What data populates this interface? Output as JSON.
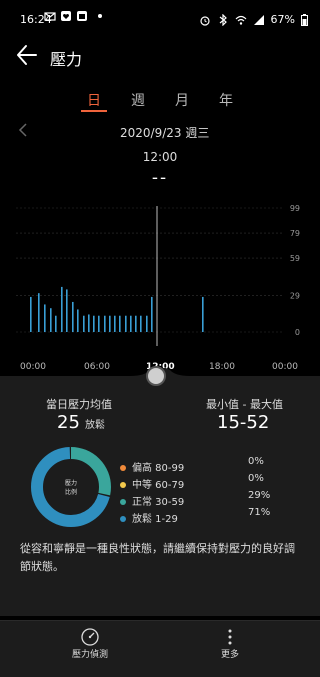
{
  "status_bar": {
    "time": "16:24",
    "battery": "67%"
  },
  "header": {
    "title": "壓力"
  },
  "tabs": [
    {
      "label": "日",
      "active": true
    },
    {
      "label": "週",
      "active": false
    },
    {
      "label": "月",
      "active": false
    },
    {
      "label": "年",
      "active": false
    }
  ],
  "date_nav": {
    "date": "2020/9/23  週三"
  },
  "readout": {
    "time": "12:00",
    "value": "--"
  },
  "chart_data": {
    "type": "bar",
    "y_ticks": [
      "99",
      "79",
      "59",
      "29",
      "0"
    ],
    "ylim": [
      0,
      99
    ],
    "x_ticks": [
      "00:00",
      "06:00",
      "12:00",
      "18:00",
      "00:00"
    ],
    "bars": [
      {
        "x": 30,
        "y": 28
      },
      {
        "x": 38,
        "y": 31
      },
      {
        "x": 44,
        "y": 22
      },
      {
        "x": 50,
        "y": 19
      },
      {
        "x": 55,
        "y": 13
      },
      {
        "x": 61,
        "y": 36
      },
      {
        "x": 66,
        "y": 34
      },
      {
        "x": 72,
        "y": 24
      },
      {
        "x": 77,
        "y": 18
      },
      {
        "x": 83,
        "y": 13
      },
      {
        "x": 88,
        "y": 14
      },
      {
        "x": 93,
        "y": 13
      },
      {
        "x": 98,
        "y": 13
      },
      {
        "x": 104,
        "y": 13
      },
      {
        "x": 109,
        "y": 13
      },
      {
        "x": 114,
        "y": 13
      },
      {
        "x": 119,
        "y": 13
      },
      {
        "x": 125,
        "y": 13
      },
      {
        "x": 130,
        "y": 13
      },
      {
        "x": 135,
        "y": 13
      },
      {
        "x": 140,
        "y": 13
      },
      {
        "x": 146,
        "y": 13
      },
      {
        "x": 151,
        "y": 28
      },
      {
        "x": 202,
        "y": 28
      }
    ],
    "cursor_x": 157
  },
  "summary": {
    "avg_label": "當日壓力均值",
    "avg_value": "25",
    "avg_unit": "放鬆",
    "range_label": "最小值 - 最大值",
    "range_value": "15-52"
  },
  "donut": {
    "center_label": "壓力\n比例",
    "slices": [
      {
        "name": "偏高 80-99",
        "pct": "0%",
        "value": 0,
        "color": "#f08a3a"
      },
      {
        "name": "中等 60-79",
        "pct": "0%",
        "value": 0,
        "color": "#f2c94c"
      },
      {
        "name": "正常 30-59",
        "pct": "29%",
        "value": 29,
        "color": "#3aa69c"
      },
      {
        "name": "放鬆 1-29",
        "pct": "71%",
        "value": 71,
        "color": "#2f8fbf"
      }
    ]
  },
  "description": "從容和寧靜是一種良性狀態，請繼續保持對壓力的良好調節狀態。",
  "bottom": {
    "left_label": "壓力偵測",
    "right_label": "更多"
  }
}
